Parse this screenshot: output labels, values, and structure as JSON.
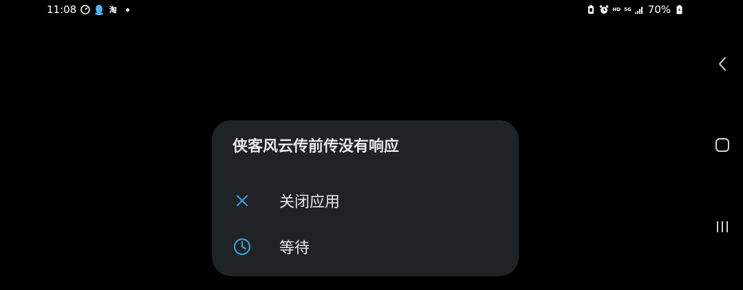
{
  "status_bar": {
    "time": "11:08",
    "taobao_label": "淘",
    "hd_label": "HD",
    "network_label": "5G",
    "battery": "70%"
  },
  "dialog": {
    "title": "侠客风云传前传没有响应",
    "options": [
      {
        "label": "关闭应用",
        "icon": "close-icon"
      },
      {
        "label": "等待",
        "icon": "clock-icon"
      }
    ]
  },
  "colors": {
    "background": "#000000",
    "dialog_bg": "#1f2326",
    "accent": "#3a9fd8"
  }
}
